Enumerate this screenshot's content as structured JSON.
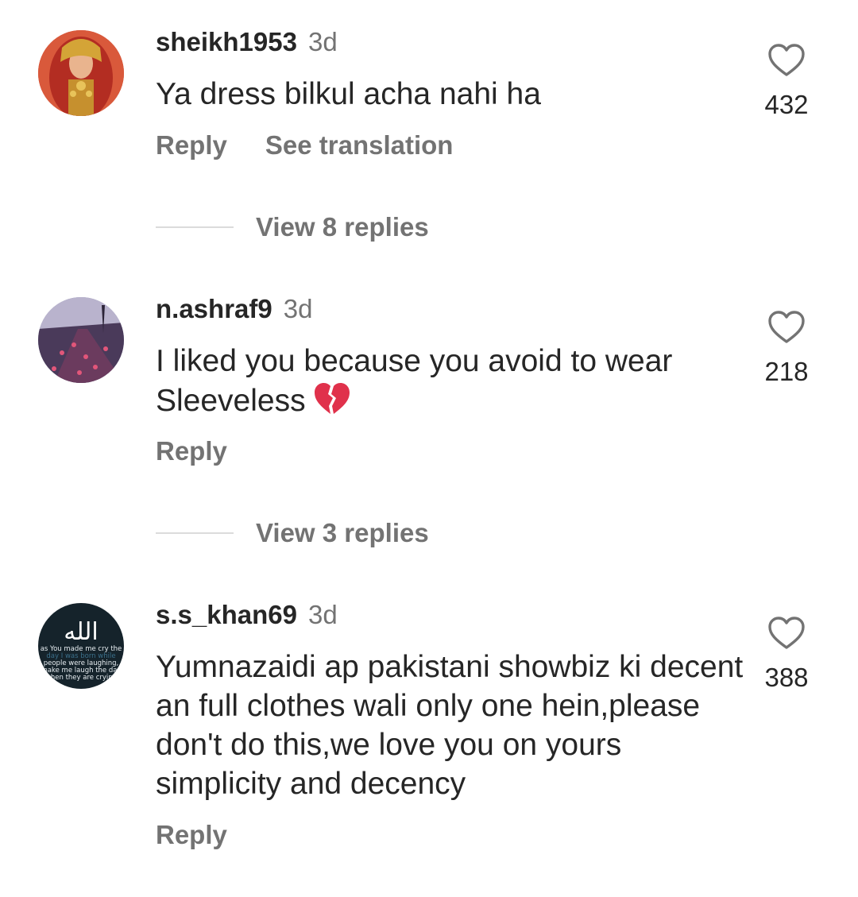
{
  "comments": [
    {
      "username": "sheikh1953",
      "time": "3d",
      "text": "Ya dress bilkul acha nahi ha",
      "likes": "432",
      "actions": {
        "reply": "Reply",
        "translate": "See translation"
      },
      "view_replies": "View 8 replies",
      "avatar": "woman-bridal-avatar"
    },
    {
      "username": "n.ashraf9",
      "time": "3d",
      "text": "I liked you because you avoid to wear Sleeveless",
      "emoji": "broken-heart",
      "likes": "218",
      "actions": {
        "reply": "Reply"
      },
      "view_replies": "View 3 replies",
      "avatar": "flower-path-avatar"
    },
    {
      "username": "s.s_khan69",
      "time": "3d",
      "text": "Yumnazaidi ap pakistani showbiz ki decent an full clothes wali only one hein,please don't do this,we love you on yours simplicity and decency",
      "likes": "388",
      "actions": {
        "reply": "Reply"
      },
      "avatar": "calligraphy-quote-avatar",
      "avatar_text": {
        "arabic": "الله",
        "line1": "as You made me cry the",
        "line2": "day I was born while",
        "line3": "people were laughing,",
        "line4": "make me laugh the day",
        "line5": "when they are crying"
      }
    }
  ],
  "colors": {
    "text": "#262626",
    "secondary": "#737373",
    "divider": "#dbdbdb",
    "broken_heart": "#e0314b"
  }
}
